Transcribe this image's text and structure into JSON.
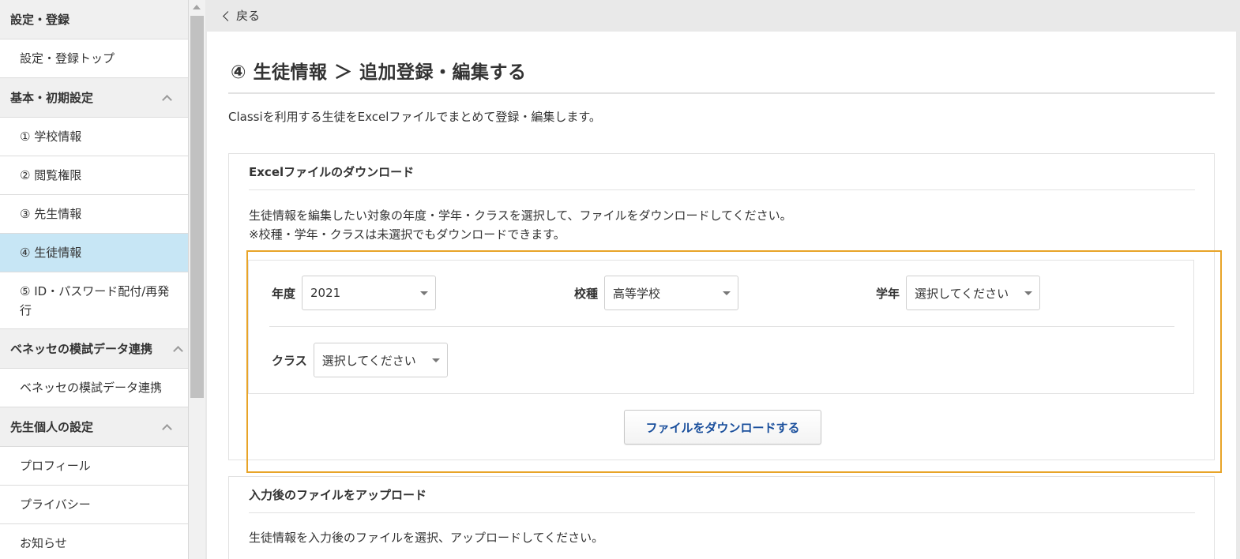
{
  "sidebar": {
    "items": [
      {
        "type": "section",
        "label": "設定・登録",
        "chevron": false
      },
      {
        "type": "item",
        "label": "設定・登録トップ"
      },
      {
        "type": "section",
        "label": "基本・初期設定",
        "chevron": true
      },
      {
        "type": "item",
        "label": "① 学校情報"
      },
      {
        "type": "item",
        "label": "② 閲覧権限"
      },
      {
        "type": "item",
        "label": "③ 先生情報"
      },
      {
        "type": "item",
        "label": "④ 生徒情報",
        "active": true
      },
      {
        "type": "item",
        "label": "⑤ ID・パスワード配付/再発行",
        "tall": true
      },
      {
        "type": "section",
        "label": "ベネッセの模試データ連携",
        "chevron": true
      },
      {
        "type": "item",
        "label": "ベネッセの模試データ連携"
      },
      {
        "type": "section",
        "label": "先生個人の設定",
        "chevron": true
      },
      {
        "type": "item",
        "label": "プロフィール"
      },
      {
        "type": "item",
        "label": "プライバシー"
      },
      {
        "type": "item",
        "label": "お知らせ"
      }
    ]
  },
  "topbar": {
    "back_label": "戻る"
  },
  "main": {
    "title": "④ 生徒情報 ＞ 追加登録・編集する",
    "intro": "Classiを利用する生徒をExcelファイルでまとめて登録・編集します。",
    "download": {
      "heading": "Excelファイルのダウンロード",
      "desc_line1": "生徒情報を編集したい対象の年度・学年・クラスを選択して、ファイルをダウンロードしてください。",
      "desc_line2": "※校種・学年・クラスは未選択でもダウンロードできます。",
      "filters": {
        "year": {
          "label": "年度",
          "value": "2021"
        },
        "school_type": {
          "label": "校種",
          "value": "高等学校"
        },
        "grade": {
          "label": "学年",
          "value": "選択してください"
        },
        "class": {
          "label": "クラス",
          "value": "選択してください"
        }
      },
      "button_label": "ファイルをダウンロードする"
    },
    "upload": {
      "heading": "入力後のファイルをアップロード",
      "desc": "生徒情報を入力後のファイルを選択、アップロードしてください。"
    }
  },
  "colors": {
    "active_item_bg": "#c7e6f5",
    "highlight_border": "#e8a428",
    "button_text": "#1a4f9c"
  }
}
